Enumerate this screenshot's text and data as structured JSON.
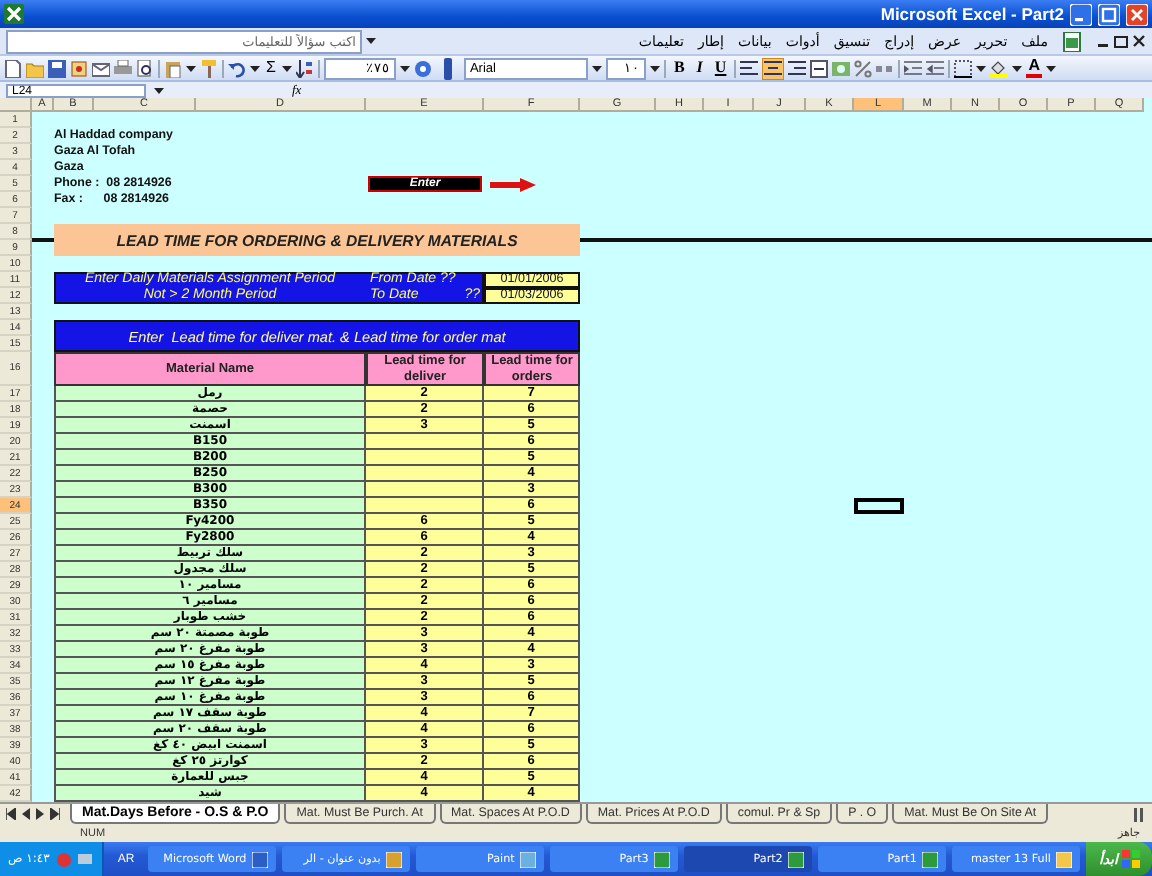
{
  "window": {
    "title": "Microsoft Excel - Part2"
  },
  "menu": {
    "items": [
      "ملف",
      "تحرير",
      "عرض",
      "إدراج",
      "تنسيق",
      "أدوات",
      "بيانات",
      "إطار",
      "تعليمات"
    ],
    "help_box": {
      "placeholder": "اكتب سؤالاً للتعليمات"
    }
  },
  "toolbar": {
    "sum": "Σ",
    "zoom": "٧٥٪",
    "font": "Arial",
    "font_size": "١٠",
    "bold": "B",
    "italic": "I",
    "underline": "U",
    "font_color": "A"
  },
  "formula_bar": {
    "name_box": "L24",
    "function": "fx"
  },
  "sheet": {
    "columns": [
      {
        "label": "Q",
        "selected": false
      },
      {
        "label": "P",
        "selected": false
      },
      {
        "label": "O",
        "selected": false
      },
      {
        "label": "N",
        "selected": false
      },
      {
        "label": "M",
        "selected": false
      },
      {
        "label": "L",
        "selected": true
      },
      {
        "label": "K",
        "selected": false
      },
      {
        "label": "J",
        "selected": false
      },
      {
        "label": "I",
        "selected": false
      },
      {
        "label": "H",
        "selected": false
      },
      {
        "label": "G",
        "selected": false
      },
      {
        "label": "F",
        "selected": false
      },
      {
        "label": "E",
        "selected": false
      },
      {
        "label": "D",
        "selected": false
      },
      {
        "label": "C",
        "selected": false
      },
      {
        "label": "B",
        "selected": false
      },
      {
        "label": "A",
        "selected": false
      }
    ],
    "rows": [
      {
        "label": "1",
        "selected": false
      },
      {
        "label": "2",
        "selected": false
      },
      {
        "label": "3",
        "selected": false
      },
      {
        "label": "4",
        "selected": false
      },
      {
        "label": "5",
        "selected": false
      },
      {
        "label": "6",
        "selected": false
      },
      {
        "label": "7",
        "selected": false
      },
      {
        "label": "8",
        "selected": false
      },
      {
        "label": "9",
        "selected": false
      },
      {
        "label": "10",
        "selected": false
      },
      {
        "label": "11",
        "selected": false
      },
      {
        "label": "12",
        "selected": false
      },
      {
        "label": "13",
        "selected": false
      },
      {
        "label": "14",
        "selected": false
      },
      {
        "label": "15",
        "selected": false
      },
      {
        "label": "16",
        "selected": false
      },
      {
        "label": "17",
        "selected": false
      },
      {
        "label": "18",
        "selected": false
      },
      {
        "label": "19",
        "selected": false
      },
      {
        "label": "20",
        "selected": false
      },
      {
        "label": "21",
        "selected": false
      },
      {
        "label": "22",
        "selected": false
      },
      {
        "label": "23",
        "selected": false
      },
      {
        "label": "24",
        "selected": true
      },
      {
        "label": "25",
        "selected": false
      },
      {
        "label": "26",
        "selected": false
      },
      {
        "label": "27",
        "selected": false
      },
      {
        "label": "28",
        "selected": false
      },
      {
        "label": "29",
        "selected": false
      },
      {
        "label": "30",
        "selected": false
      },
      {
        "label": "31",
        "selected": false
      },
      {
        "label": "32",
        "selected": false
      },
      {
        "label": "33",
        "selected": false
      },
      {
        "label": "34",
        "selected": false
      },
      {
        "label": "35",
        "selected": false
      },
      {
        "label": "36",
        "selected": false
      },
      {
        "label": "37",
        "selected": false
      },
      {
        "label": "38",
        "selected": false
      },
      {
        "label": "39",
        "selected": false
      },
      {
        "label": "40",
        "selected": false
      },
      {
        "label": "41",
        "selected": false
      },
      {
        "label": "42",
        "selected": false
      }
    ],
    "company": [
      "Al Haddad company",
      "Gaza Al Tofah",
      "Gaza",
      "Phone :  08 2814926",
      "Fax :      08 2814926"
    ],
    "enter_button": "Enter",
    "title": "LEAD TIME FOR ORDERING & DELIVERY MATERIALS",
    "period": {
      "line_1": "Enter Daily Materials Assignment Period",
      "line_2": "Not > 2 Month Period",
      "from_label": "From Date ??",
      "from_value": "01/01/2006",
      "to_label": "To Date",
      "to_marks": "??",
      "to_value": "01/03/2006"
    },
    "table": {
      "caption": "Enter  Lead time for deliver mat. & Lead time for order mat",
      "columns": [
        "Lead time for orders",
        "Lead time for deliver",
        "Material Name"
      ],
      "rows": [
        {
          "name": "رمل",
          "deliver": "2",
          "orders": "7"
        },
        {
          "name": "حصمة",
          "deliver": "2",
          "orders": "6"
        },
        {
          "name": "اسمنت",
          "deliver": "3",
          "orders": "5"
        },
        {
          "name": "B150",
          "orders": "6"
        },
        {
          "name": "B200",
          "orders": "5"
        },
        {
          "name": "B250",
          "orders": "4"
        },
        {
          "name": "B300",
          "orders": "3"
        },
        {
          "name": "B350",
          "orders": "6"
        },
        {
          "name": "Fy4200",
          "deliver": "6",
          "orders": "5"
        },
        {
          "name": "Fy2800",
          "deliver": "6",
          "orders": "4"
        },
        {
          "name": "سلك تربيط",
          "deliver": "2",
          "orders": "3"
        },
        {
          "name": "سلك مجدول",
          "deliver": "2",
          "orders": "5"
        },
        {
          "name": "مسامير ١٠",
          "deliver": "2",
          "orders": "6"
        },
        {
          "name": "مسامير ٦",
          "deliver": "2",
          "orders": "6"
        },
        {
          "name": "خشب طوبار",
          "deliver": "2",
          "orders": "6"
        },
        {
          "name": "طوبة مصمتة ٢٠ سم",
          "deliver": "3",
          "orders": "4"
        },
        {
          "name": "طوبة مفرغ ٢٠ سم",
          "deliver": "3",
          "orders": "4"
        },
        {
          "name": "طوبة مفرغ ١٥ سم",
          "deliver": "4",
          "orders": "3"
        },
        {
          "name": "طوبة مفرغ ١٢ سم",
          "deliver": "3",
          "orders": "5"
        },
        {
          "name": "طوبة مفرغ ١٠ سم",
          "deliver": "3",
          "orders": "6"
        },
        {
          "name": "طوبة سقف ١٧ سم",
          "deliver": "4",
          "orders": "7"
        },
        {
          "name": "طوبة سقف ٢٠ سم",
          "deliver": "4",
          "orders": "6"
        },
        {
          "name": "اسمنت ابيض ٤٠ كغ",
          "deliver": "3",
          "orders": "5"
        },
        {
          "name": "كوارتز ٢٥ كغ",
          "deliver": "2",
          "orders": "6"
        },
        {
          "name": "جبس للعمارة",
          "deliver": "4",
          "orders": "5"
        },
        {
          "name": "شيد",
          "deliver": "4",
          "orders": "4"
        }
      ]
    }
  },
  "sheet_tabs": [
    {
      "label": "Mat. Must Be On Site At",
      "selected": false
    },
    {
      "label": "P . O",
      "selected": false
    },
    {
      "label": "comul. Pr & Sp",
      "selected": false
    },
    {
      "label": "Mat. Prices At P.O.D",
      "selected": false
    },
    {
      "label": "Mat. Spaces At P.O.D",
      "selected": false
    },
    {
      "label": "Mat. Must Be Purch. At",
      "selected": false
    },
    {
      "label": "Mat.Days Before - O.S & P.O",
      "selected": true
    }
  ],
  "status_bar": {
    "mode": "NUM",
    "status": "جاهز"
  },
  "taskbar": {
    "clock": "١:٤٣ ص",
    "language": "AR",
    "start": "ابدأ",
    "tasks": [
      {
        "label": "master 13 Full",
        "selected": false
      },
      {
        "label": "Part1",
        "selected": false
      },
      {
        "label": "Part2",
        "selected": true
      },
      {
        "label": "Part3",
        "selected": false
      },
      {
        "label": "Paint",
        "selected": false
      },
      {
        "label": "بدون عنوان - الر",
        "selected": false
      },
      {
        "label": "Microsoft Word",
        "selected": false
      }
    ]
  }
}
